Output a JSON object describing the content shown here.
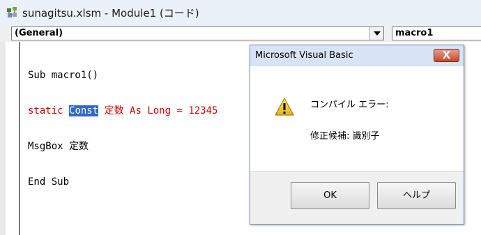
{
  "window": {
    "title": "sunagitsu.xlsm - Module1 (コード)",
    "icon": "vba-project-icon"
  },
  "combos": {
    "object_value": "(General)",
    "procedure_value": "macro1"
  },
  "code": {
    "line1": "Sub macro1()",
    "line2_pre": "static ",
    "line2_sel": "Const",
    "line2_post": " 定数 As Long = 12345",
    "line3": "MsgBox 定数",
    "line4": "End Sub"
  },
  "dialog": {
    "title": "Microsoft Visual Basic",
    "close_symbol": "X",
    "icon": "warning-icon",
    "message_line1": "コンパイル エラー:",
    "message_line2": "修正候補: 識別子",
    "ok_label": "OK",
    "help_label": "ヘルプ"
  },
  "colors": {
    "error_text": "#cc0000",
    "selection": "#3168c9",
    "close_button": "#c7472c"
  }
}
